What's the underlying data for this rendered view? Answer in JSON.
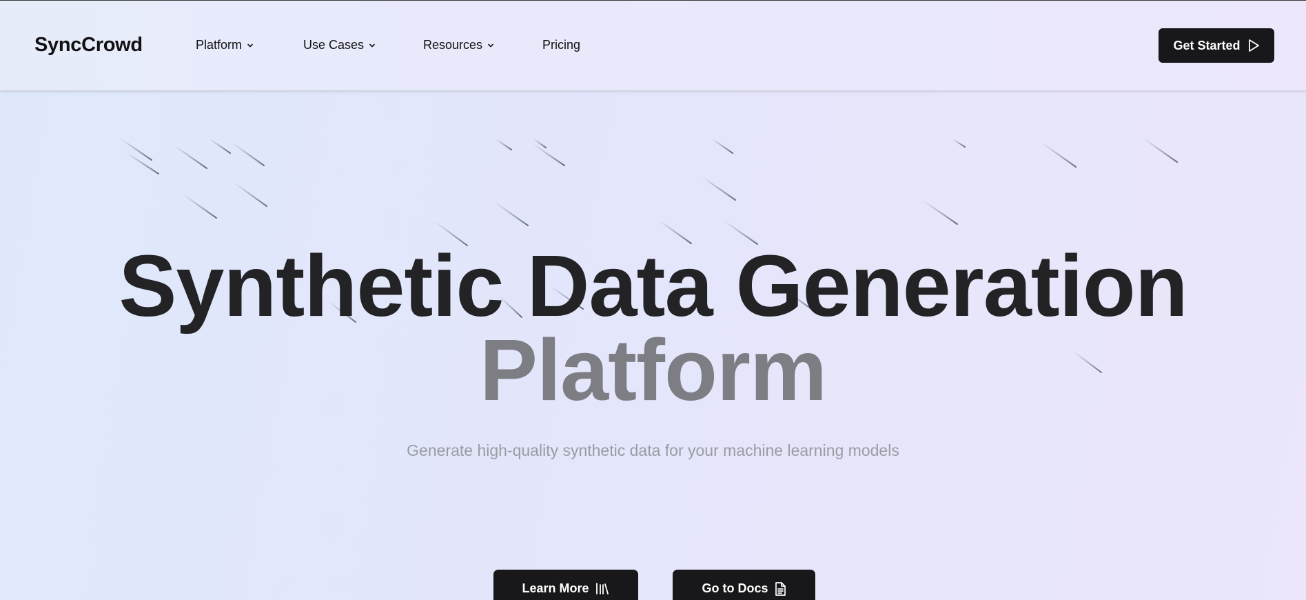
{
  "header": {
    "logo": "SyncCrowd",
    "nav": [
      {
        "label": "Platform",
        "dropdown": true
      },
      {
        "label": "Use Cases",
        "dropdown": true
      },
      {
        "label": "Resources",
        "dropdown": true
      },
      {
        "label": "Pricing",
        "dropdown": false
      }
    ],
    "cta_label": "Get Started",
    "cta_icon": "play-icon"
  },
  "hero": {
    "title_line1": "Synthetic Data Generation",
    "title_line2": "Platform",
    "subtitle": "Generate high-quality synthetic data for your machine learning models",
    "buttons": [
      {
        "label": "Learn More",
        "icon": "library-icon"
      },
      {
        "label": "Go to Docs",
        "icon": "file-text-icon"
      }
    ]
  },
  "colors": {
    "primary_button": "#18181b",
    "title": "#232326",
    "title_muted": "#7d7e84",
    "subtitle": "#9a9ca3"
  }
}
